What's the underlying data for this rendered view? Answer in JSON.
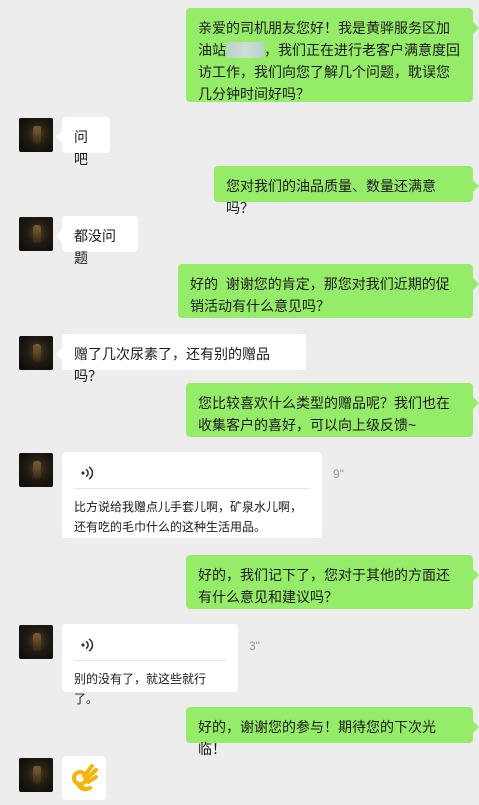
{
  "messages": [
    {
      "type": "out",
      "parts": [
        "亲爱的司机朋友您好！我是黄骅服务区加油站",
        "，我们正在进行老客户满意度回访工作，我们向您了解几个问题，耽误您几分钟时间好吗？"
      ]
    },
    {
      "type": "in",
      "text": "问吧"
    },
    {
      "type": "out",
      "text": "您对我们的油品质量、数量还满意吗？"
    },
    {
      "type": "in",
      "text": "都没问题"
    },
    {
      "type": "out",
      "text": "好的  谢谢您的肯定，那您对我们近期的促销活动有什么意见吗？"
    },
    {
      "type": "in",
      "text": "赠了几次尿素了，还有别的赠品吗？"
    },
    {
      "type": "out",
      "text": "您比较喜欢什么类型的赠品呢？我们也在收集客户的喜好，可以向上级反馈~"
    },
    {
      "type": "voice",
      "duration": "9\"",
      "transcript": "比方说给我赠点儿手套儿啊，矿泉水儿啊，还有吃的毛巾什么的这种生活用品。"
    },
    {
      "type": "out",
      "text": "好的，我们记下了，您对于其他的方面还有什么意见和建议吗？"
    },
    {
      "type": "voice",
      "duration": "3\"",
      "transcript": "别的没有了，就这些就行了。"
    },
    {
      "type": "out",
      "text": "好的，谢谢您的参与！期待您的下次光临！"
    },
    {
      "type": "emoji",
      "icon": "ok-hand-emoji"
    }
  ],
  "colors": {
    "background": "#ededed",
    "outgoing": "#95ec69",
    "incoming": "#ffffff"
  }
}
